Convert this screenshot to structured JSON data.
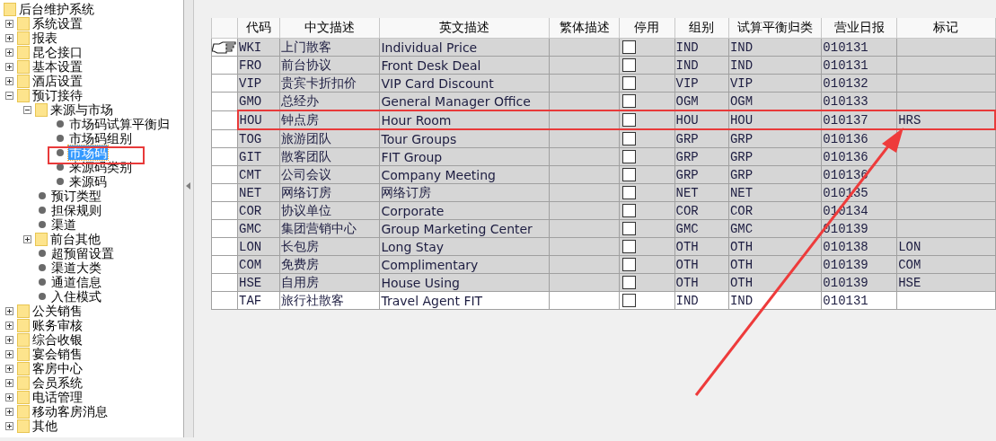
{
  "tree": [
    {
      "label": "后台维护系统",
      "kind": "folder",
      "selected": false,
      "children": [
        {
          "label": "系统设置",
          "kind": "folder",
          "expanded": false,
          "selected": false
        },
        {
          "label": "报表",
          "kind": "folder",
          "expanded": false,
          "selected": false
        },
        {
          "label": "昆仑接口",
          "kind": "folder",
          "expanded": false,
          "selected": false
        },
        {
          "label": "基本设置",
          "kind": "folder",
          "expanded": false,
          "selected": false
        },
        {
          "label": "酒店设置",
          "kind": "folder",
          "expanded": false,
          "selected": false
        },
        {
          "label": "预订接待",
          "kind": "folder",
          "expanded": true,
          "selected": false,
          "children": [
            {
              "label": "来源与市场",
              "kind": "folder",
              "expanded": true,
              "selected": false,
              "children": [
                {
                  "label": "市场码试算平衡归",
                  "kind": "leaf",
                  "selected": false
                },
                {
                  "label": "市场码组别",
                  "kind": "leaf",
                  "selected": false
                },
                {
                  "label": "市场码",
                  "kind": "leaf",
                  "selected": true
                },
                {
                  "label": "来源码类别",
                  "kind": "leaf",
                  "selected": false
                },
                {
                  "label": "来源码",
                  "kind": "leaf",
                  "selected": false
                }
              ]
            },
            {
              "label": "预订类型",
              "kind": "leaf",
              "selected": false
            },
            {
              "label": "担保规则",
              "kind": "leaf",
              "selected": false
            },
            {
              "label": "渠道",
              "kind": "leaf",
              "selected": false
            },
            {
              "label": "前台其他",
              "kind": "folder",
              "expanded": false,
              "selected": false
            },
            {
              "label": "超预留设置",
              "kind": "leaf",
              "selected": false
            },
            {
              "label": "渠道大类",
              "kind": "leaf",
              "selected": false
            },
            {
              "label": "通道信息",
              "kind": "leaf",
              "selected": false
            },
            {
              "label": "入住模式",
              "kind": "leaf",
              "selected": false
            }
          ]
        },
        {
          "label": "公关销售",
          "kind": "folder",
          "expanded": false,
          "selected": false
        },
        {
          "label": "账务审核",
          "kind": "folder",
          "expanded": false,
          "selected": false
        },
        {
          "label": "综合收银",
          "kind": "folder",
          "expanded": false,
          "selected": false
        },
        {
          "label": "宴会销售",
          "kind": "folder",
          "expanded": false,
          "selected": false
        },
        {
          "label": "客房中心",
          "kind": "folder",
          "expanded": false,
          "selected": false
        },
        {
          "label": "会员系统",
          "kind": "folder",
          "expanded": false,
          "selected": false
        },
        {
          "label": "电话管理",
          "kind": "folder",
          "expanded": false,
          "selected": false
        },
        {
          "label": "移动客房消息",
          "kind": "folder",
          "expanded": false,
          "selected": false
        },
        {
          "label": "其他",
          "kind": "folder",
          "expanded": false,
          "selected": false
        }
      ]
    }
  ],
  "table": {
    "columns": [
      "代码",
      "中文描述",
      "英文描述",
      "繁体描述",
      "停用",
      "组别",
      "试算平衡归类",
      "营业日报",
      "标记"
    ],
    "rows": [
      {
        "code": "WKI",
        "cn": "上门散客",
        "en": "Individual Price",
        "disabled": false,
        "group": "IND",
        "trial": "IND",
        "daily": "010131",
        "shaded": true,
        "current": true,
        "highlighted": false
      },
      {
        "code": "FRO",
        "cn": "前台协议",
        "en": "Front Desk Deal",
        "disabled": false,
        "group": "IND",
        "trial": "IND",
        "daily": "010131",
        "shaded": true,
        "current": false,
        "highlighted": false
      },
      {
        "code": "VIP",
        "cn": "贵宾卡折扣价",
        "en": "VIP Card Discount",
        "disabled": false,
        "group": "VIP",
        "trial": "VIP",
        "daily": "010132",
        "shaded": true,
        "current": false,
        "highlighted": false
      },
      {
        "code": "GMO",
        "cn": "总经办",
        "en": "General Manager Office",
        "disabled": false,
        "group": "OGM",
        "trial": "OGM",
        "daily": "010133",
        "shaded": true,
        "current": false,
        "highlighted": false
      },
      {
        "code": "HOU",
        "cn": "钟点房",
        "en": "Hour Room",
        "disabled": false,
        "group": "HOU",
        "trial": "HOU",
        "daily": "010137",
        "mark": "HRS",
        "shaded": true,
        "current": false,
        "highlighted": true
      },
      {
        "code": "TOG",
        "cn": "旅游团队",
        "en": "Tour Groups",
        "disabled": false,
        "group": "GRP",
        "trial": "GRP",
        "daily": "010136",
        "shaded": true,
        "current": false,
        "highlighted": false
      },
      {
        "code": "GIT",
        "cn": "散客团队",
        "en": "FIT Group",
        "disabled": false,
        "group": "GRP",
        "trial": "GRP",
        "daily": "010136",
        "shaded": true,
        "current": false,
        "highlighted": false
      },
      {
        "code": "CMT",
        "cn": "公司会议",
        "en": "Company Meeting",
        "disabled": false,
        "group": "GRP",
        "trial": "GRP",
        "daily": "010136",
        "shaded": true,
        "current": false,
        "highlighted": false
      },
      {
        "code": "NET",
        "cn": "网络订房",
        "en": "网络订房",
        "disabled": false,
        "group": "NET",
        "trial": "NET",
        "daily": "010135",
        "shaded": true,
        "current": false,
        "highlighted": false
      },
      {
        "code": "COR",
        "cn": "协议单位",
        "en": "Corporate",
        "disabled": false,
        "group": "COR",
        "trial": "COR",
        "daily": "010134",
        "shaded": true,
        "current": false,
        "highlighted": false
      },
      {
        "code": "GMC",
        "cn": "集团营销中心",
        "en": "Group Marketing Center",
        "disabled": false,
        "group": "GMC",
        "trial": "GMC",
        "daily": "010139",
        "shaded": true,
        "current": false,
        "highlighted": false
      },
      {
        "code": "LON",
        "cn": "长包房",
        "en": "Long Stay",
        "disabled": false,
        "group": "OTH",
        "trial": "OTH",
        "daily": "010138",
        "mark": "LON",
        "shaded": true,
        "current": false,
        "highlighted": false
      },
      {
        "code": "COM",
        "cn": "免费房",
        "en": "Complimentary",
        "disabled": false,
        "group": "OTH",
        "trial": "OTH",
        "daily": "010139",
        "mark": "COM",
        "shaded": true,
        "current": false,
        "highlighted": false
      },
      {
        "code": "HSE",
        "cn": "自用房",
        "en": "House Using",
        "disabled": false,
        "group": "OTH",
        "trial": "OTH",
        "daily": "010139",
        "mark": "HSE",
        "shaded": true,
        "current": false,
        "highlighted": false
      },
      {
        "code": "TAF",
        "cn": "旅行社散客",
        "en": "Travel Agent FIT",
        "disabled": false,
        "group": "IND",
        "trial": "IND",
        "daily": "010131",
        "shaded": false,
        "current": false,
        "highlighted": false
      }
    ]
  }
}
